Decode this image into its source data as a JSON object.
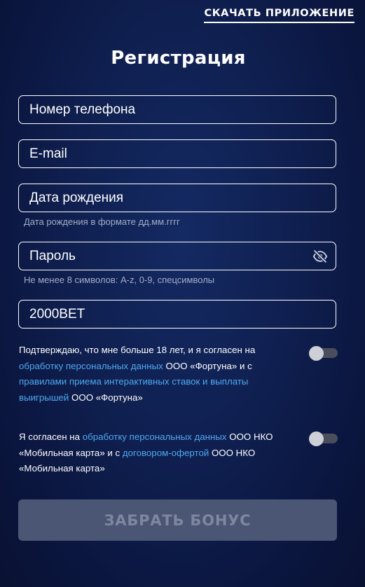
{
  "header": {
    "download_label": "СКАЧАТЬ ПРИЛОЖЕНИЕ"
  },
  "form": {
    "title": "Регистрация",
    "phone": {
      "placeholder": "Номер телефона"
    },
    "email": {
      "placeholder": "E-mail"
    },
    "birthdate": {
      "placeholder": "Дата рождения",
      "hint": "Дата рождения в формате дд.мм.гггг"
    },
    "password": {
      "placeholder": "Пароль",
      "hint": "Не менее 8 символов: A-z, 0-9, спецсимволы",
      "icon": "eye-off-icon"
    },
    "promo": {
      "value": "2000BET"
    },
    "consent1": {
      "part1": "Подтверждаю, что мне больше 18 лет, и я согласен на ",
      "link1": "обработку персональных данных",
      "part2": " ООО «Фортуна» и с ",
      "link2": "правилами приема интерактивных ставок и выплаты выигрышей",
      "part3": " ООО «Фортуна»",
      "enabled": false
    },
    "consent2": {
      "part1": "Я согласен на ",
      "link1": "обработку персональных данных",
      "part2": " ООО НКО «Мобильная карта» и с ",
      "link2": "договором-офертой",
      "part3": " ООО НКО «Мобильная карта»",
      "enabled": false
    },
    "submit_label": "ЗАБРАТЬ БОНУС"
  },
  "colors": {
    "background": "#0f1f4f",
    "link": "#4fa9f2",
    "hint": "#a3adc7",
    "button_disabled_bg": "#4b5674",
    "button_disabled_text": "#7d879f"
  }
}
